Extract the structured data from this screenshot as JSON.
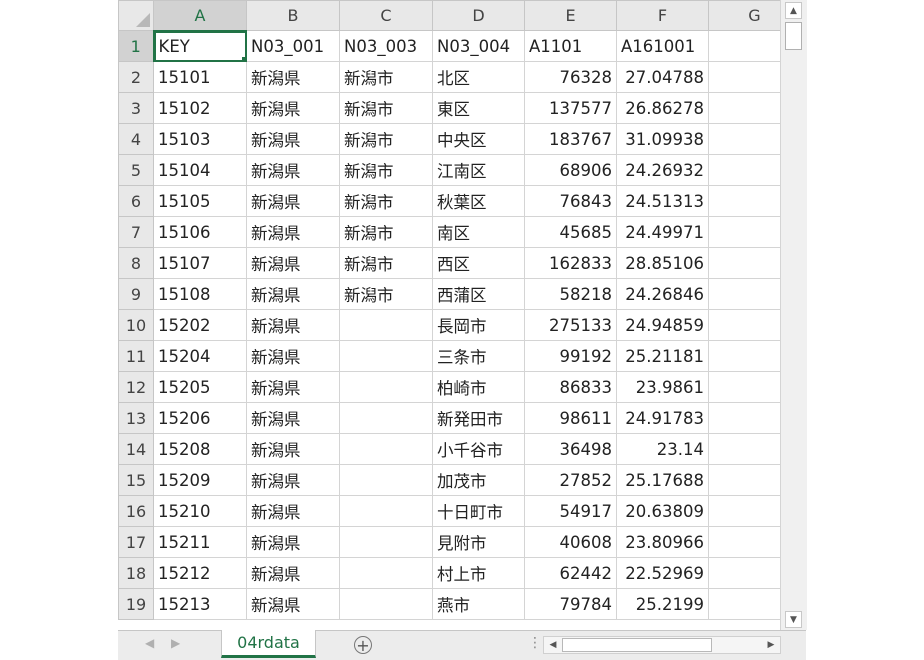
{
  "columns": [
    "A",
    "B",
    "C",
    "D",
    "E",
    "F",
    "G"
  ],
  "selected_column": "A",
  "selected_row": "1",
  "rows": [
    {
      "num": "1",
      "cells": [
        "KEY",
        "N03_001",
        "N03_003",
        "N03_004",
        "A1101",
        "A161001",
        ""
      ]
    },
    {
      "num": "2",
      "cells": [
        "15101",
        "新潟県",
        "新潟市",
        "北区",
        "76328",
        "27.04788",
        ""
      ]
    },
    {
      "num": "3",
      "cells": [
        "15102",
        "新潟県",
        "新潟市",
        "東区",
        "137577",
        "26.86278",
        ""
      ]
    },
    {
      "num": "4",
      "cells": [
        "15103",
        "新潟県",
        "新潟市",
        "中央区",
        "183767",
        "31.09938",
        ""
      ]
    },
    {
      "num": "5",
      "cells": [
        "15104",
        "新潟県",
        "新潟市",
        "江南区",
        "68906",
        "24.26932",
        ""
      ]
    },
    {
      "num": "6",
      "cells": [
        "15105",
        "新潟県",
        "新潟市",
        "秋葉区",
        "76843",
        "24.51313",
        ""
      ]
    },
    {
      "num": "7",
      "cells": [
        "15106",
        "新潟県",
        "新潟市",
        "南区",
        "45685",
        "24.49971",
        ""
      ]
    },
    {
      "num": "8",
      "cells": [
        "15107",
        "新潟県",
        "新潟市",
        "西区",
        "162833",
        "28.85106",
        ""
      ]
    },
    {
      "num": "9",
      "cells": [
        "15108",
        "新潟県",
        "新潟市",
        "西蒲区",
        "58218",
        "24.26846",
        ""
      ]
    },
    {
      "num": "10",
      "cells": [
        "15202",
        "新潟県",
        "",
        "長岡市",
        "275133",
        "24.94859",
        ""
      ]
    },
    {
      "num": "11",
      "cells": [
        "15204",
        "新潟県",
        "",
        "三条市",
        "99192",
        "25.21181",
        ""
      ]
    },
    {
      "num": "12",
      "cells": [
        "15205",
        "新潟県",
        "",
        "柏崎市",
        "86833",
        "23.9861",
        ""
      ]
    },
    {
      "num": "13",
      "cells": [
        "15206",
        "新潟県",
        "",
        "新発田市",
        "98611",
        "24.91783",
        ""
      ]
    },
    {
      "num": "14",
      "cells": [
        "15208",
        "新潟県",
        "",
        "小千谷市",
        "36498",
        "23.14",
        ""
      ]
    },
    {
      "num": "15",
      "cells": [
        "15209",
        "新潟県",
        "",
        "加茂市",
        "27852",
        "25.17688",
        ""
      ]
    },
    {
      "num": "16",
      "cells": [
        "15210",
        "新潟県",
        "",
        "十日町市",
        "54917",
        "20.63809",
        ""
      ]
    },
    {
      "num": "17",
      "cells": [
        "15211",
        "新潟県",
        "",
        "見附市",
        "40608",
        "23.80966",
        ""
      ]
    },
    {
      "num": "18",
      "cells": [
        "15212",
        "新潟県",
        "",
        "村上市",
        "62442",
        "22.52969",
        ""
      ]
    },
    {
      "num": "19",
      "cells": [
        "15213",
        "新潟県",
        "",
        "燕市",
        "79784",
        "25.2199",
        ""
      ]
    }
  ],
  "sheet_tab": "04rdata",
  "icons": {
    "prev_sheet": "◀",
    "next_sheet": "▶",
    "add_sheet": "+",
    "scroll_up": "▲",
    "scroll_down": "▼",
    "scroll_left": "◀",
    "scroll_right": "▶",
    "tab_split": "⋮"
  },
  "colors": {
    "accent": "#217346",
    "header_bg": "#e8e8e8",
    "gridline": "#d4d4d4"
  }
}
